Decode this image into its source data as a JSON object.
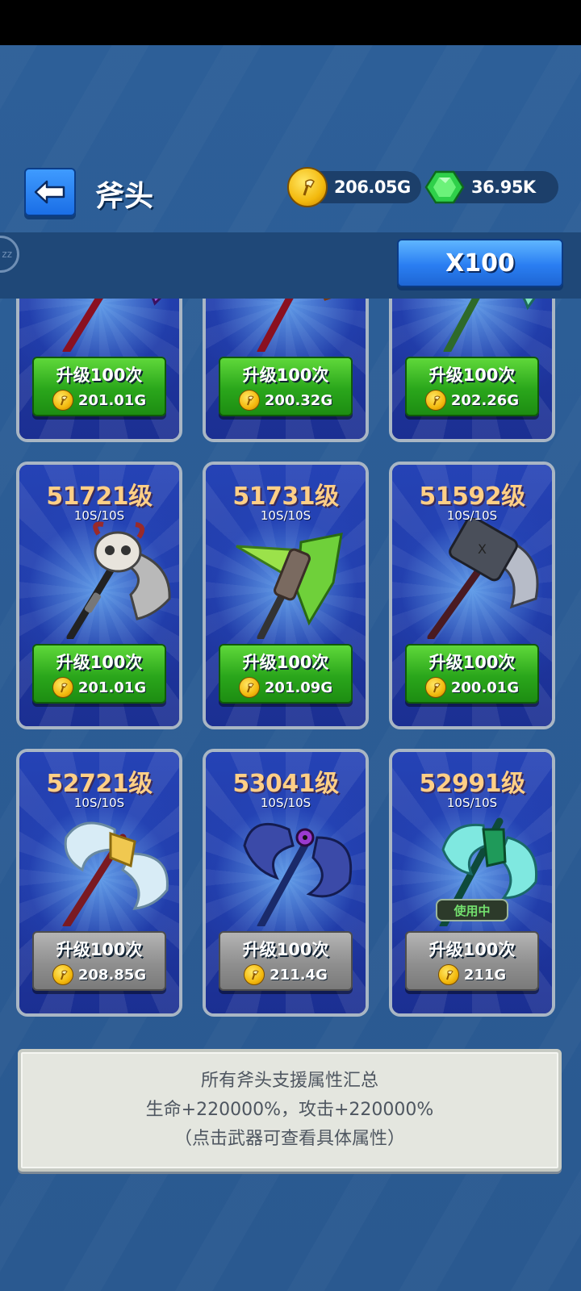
{
  "header": {
    "title": "斧头",
    "gold_amount": "206.05G",
    "gem_amount": "36.95K",
    "zz_label": "zz"
  },
  "toolbar": {
    "multiplier_label": "X100"
  },
  "cards": [
    {
      "level": "",
      "rate": "",
      "button_label": "升级100次",
      "cost": "201.01G",
      "button_style": "green",
      "in_use": false,
      "weapon_icon": "purple-axe-icon"
    },
    {
      "level": "",
      "rate": "",
      "button_label": "升级100次",
      "cost": "200.32G",
      "button_style": "green",
      "in_use": false,
      "weapon_icon": "orange-axe-icon"
    },
    {
      "level": "",
      "rate": "",
      "button_label": "升级100次",
      "cost": "202.26G",
      "button_style": "green",
      "in_use": false,
      "weapon_icon": "teal-axe-icon"
    },
    {
      "level": "51721级",
      "rate": "10S/10S",
      "button_label": "升级100次",
      "cost": "201.01G",
      "button_style": "green",
      "in_use": false,
      "weapon_icon": "skull-axe-icon"
    },
    {
      "level": "51731级",
      "rate": "10S/10S",
      "button_label": "升级100次",
      "cost": "201.09G",
      "button_style": "green",
      "in_use": false,
      "weapon_icon": "leaf-axe-icon"
    },
    {
      "level": "51592级",
      "rate": "10S/10S",
      "button_label": "升级100次",
      "cost": "200.01G",
      "button_style": "green",
      "in_use": false,
      "weapon_icon": "hammer-axe-icon"
    },
    {
      "level": "52721级",
      "rate": "10S/10S",
      "button_label": "升级100次",
      "cost": "208.85G",
      "button_style": "gray",
      "in_use": false,
      "weapon_icon": "ice-double-axe-icon"
    },
    {
      "level": "53041级",
      "rate": "10S/10S",
      "button_label": "升级100次",
      "cost": "211.4G",
      "button_style": "gray",
      "in_use": false,
      "weapon_icon": "dark-eye-axe-icon"
    },
    {
      "level": "52991级",
      "rate": "10S/10S",
      "button_label": "升级100次",
      "cost": "211G",
      "button_style": "gray",
      "in_use": true,
      "in_use_label": "使用中",
      "weapon_icon": "emerald-axe-icon"
    }
  ],
  "summary": {
    "line1": "所有斧头支援属性汇总",
    "line2": "生命+220000%，攻击+220000%",
    "line3": "（点击武器可查看具体属性）"
  },
  "colors": {
    "background": "#2a5a92",
    "level_text": "#ffcf86",
    "button_green": "#2aa61b",
    "button_gray": "#8f8f8f",
    "accent_blue": "#2a7ef2"
  }
}
